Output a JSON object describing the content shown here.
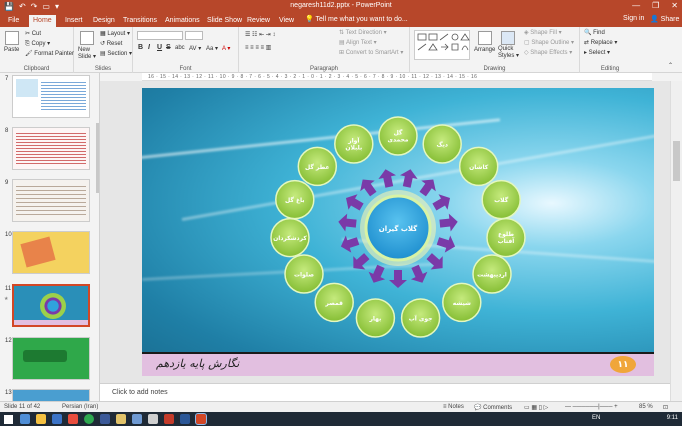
{
  "window": {
    "title": "negaresh11d2.pptx - PowerPoint",
    "qat": [
      "💾",
      "↶",
      "↷",
      "▭",
      "▾"
    ],
    "controls": [
      "—",
      "❐",
      "✕"
    ]
  },
  "tabs": [
    "File",
    "Home",
    "Insert",
    "Design",
    "Transitions",
    "Animations",
    "Slide Show",
    "Review",
    "View"
  ],
  "tell_me": "💡 Tell me what you want to do...",
  "sign_in": "Sign in",
  "share": "👤 Share",
  "ribbon": {
    "clipboard": {
      "label": "Clipboard",
      "paste": "Paste",
      "cut": "✂ Cut",
      "copy": "⎘ Copy ▾",
      "format_painter": "🖌 Format Painter"
    },
    "slides": {
      "label": "Slides",
      "new_slide": "New\nSlide ▾",
      "layout": "▦ Layout ▾",
      "reset": "↺ Reset",
      "section": "▤ Section ▾"
    },
    "font": {
      "label": "Font",
      "bold": "B",
      "italic": "I",
      "underline": "U",
      "strike": "S",
      "shadow": "abc",
      "spacing": "AV ▾",
      "case": "Aa ▾",
      "color": "A ▾"
    },
    "paragraph": {
      "label": "Paragraph",
      "text_direction": "⇅ Text Direction ▾",
      "align_text": "▤ Align Text ▾",
      "smartart": "⊞ Convert to SmartArt ▾"
    },
    "drawing": {
      "label": "Drawing",
      "arrange": "Arrange",
      "quick_styles": "Quick\nStyles ▾",
      "shape_fill": "◈ Shape Fill ▾",
      "shape_outline": "▢ Shape Outline ▾",
      "shape_effects": "◇ Shape Effects ▾"
    },
    "editing": {
      "label": "Editing",
      "find": "🔍 Find",
      "replace": "⇄ Replace ▾",
      "select": "▸ Select ▾"
    }
  },
  "ruler_text": "16 · 15 · 14 · 13 · 12 · 11 · 10 · 9 · 8 · 7 · 6 · 5 · 4 · 3 · 2 · 1 · 0 · 1 · 2 · 3 · 4 · 5 · 6 · 7 · 8 · 9 · 10 · 11 · 12 · 13 · 14 · 15 · 16",
  "thumbnails": [
    {
      "num": "7",
      "color": "#e8f4fb"
    },
    {
      "num": "8",
      "color": "#fdf5f5"
    },
    {
      "num": "9",
      "color": "#f5f2ee"
    },
    {
      "num": "10",
      "color": "#f4d25f"
    },
    {
      "num": "11",
      "color": "#2a8fb8",
      "selected": true
    },
    {
      "num": "12",
      "color": "#2fa84a"
    },
    {
      "num": "13",
      "color": "#4a9ed0"
    }
  ],
  "slide": {
    "center_label": "گلاب گیران",
    "petals": [
      "گل محمدی",
      "دیگ",
      "کاشان",
      "گلاب",
      "طلوع آفتاب",
      "اردیبهشت",
      "شیشه",
      "جوی آب",
      "بهار",
      "قمصر",
      "صلوات",
      "کردشکردان",
      "باغ گل",
      "عطر گل",
      "آواز بلبلان"
    ],
    "signature": "نگارش پایه یازدهم",
    "page_number": "۱۱",
    "colors": {
      "petal": "#9cd04a",
      "center": "#2fa3dd",
      "arrow": "#7a3aa8"
    }
  },
  "notes_placeholder": "Click to add notes",
  "status": {
    "slide": "Slide 11 of 42",
    "lang": "Persian (Iran)",
    "notes": "≡ Notes",
    "comments": "💬 Comments",
    "zoom": "85 %"
  },
  "taskbar": {
    "lang": "EN",
    "time": "9:11"
  }
}
